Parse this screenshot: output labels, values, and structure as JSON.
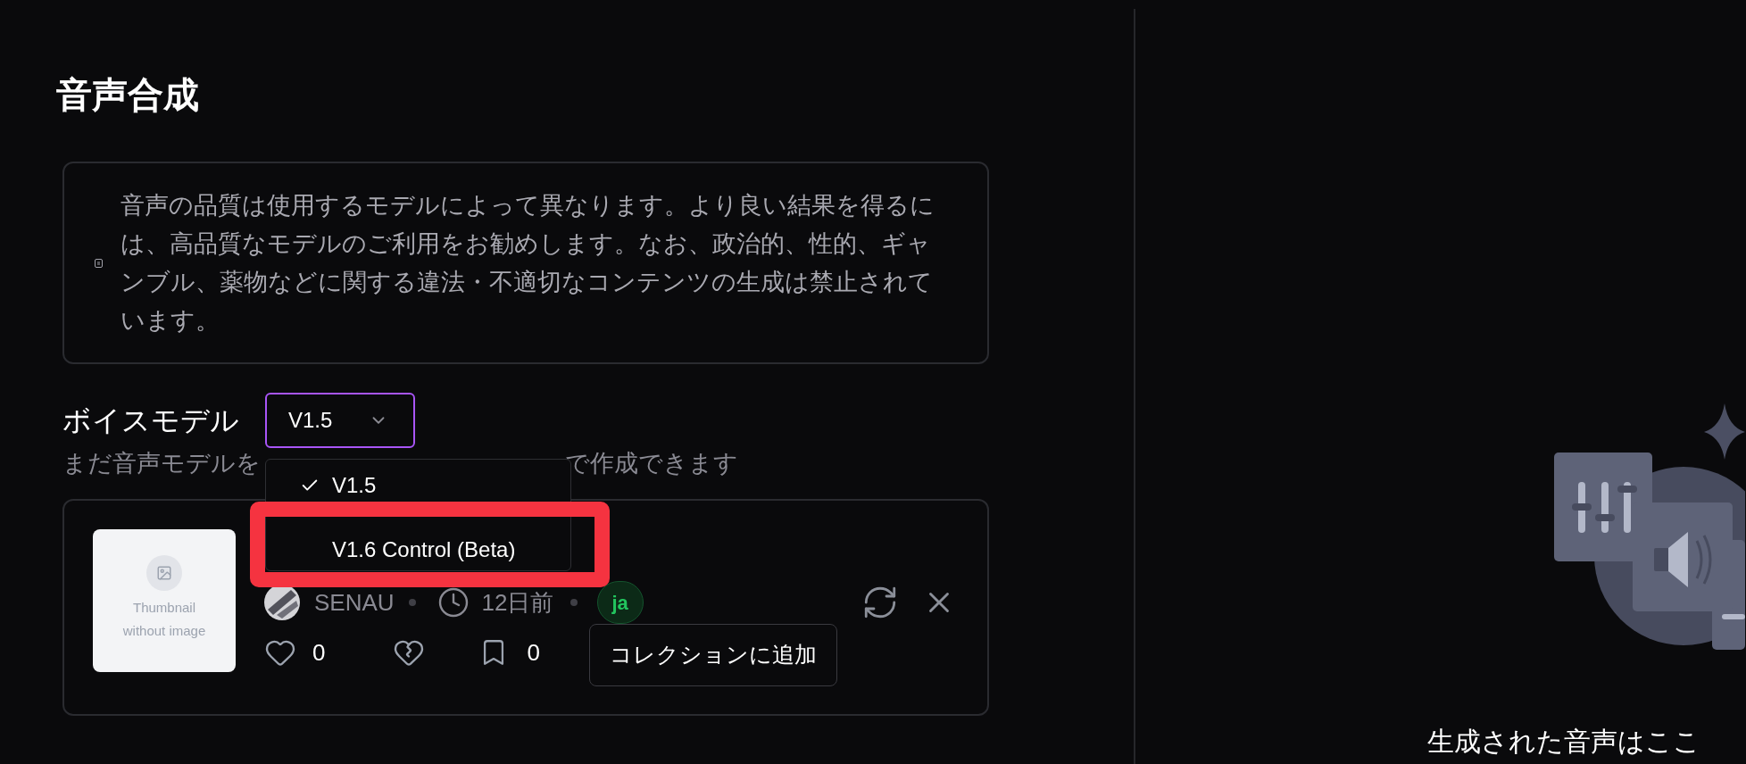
{
  "page_title": "音声合成",
  "notice": {
    "text": "音声の品質は使用するモデルによって異なります。より良い結果を得るには、高品質なモデルのご利用をお勧めします。なお、政治的、性的、ギャンブル、薬物などに関する違法・不適切なコンテンツの生成は禁止されています。"
  },
  "voice_model": {
    "label": "ボイスモデル",
    "value": "V1.5",
    "hint_before": "まだ音声モデルを",
    "hint_after": "で作成できます",
    "menu": [
      {
        "label": "V1.5",
        "selected": true
      },
      {
        "label": "V1.6 Control (Beta)",
        "selected": false
      }
    ]
  },
  "voice_card": {
    "thumbnail_lines": [
      "Thumbnail",
      "without image"
    ],
    "author": "SENAU",
    "age": "12日前",
    "language": "ja",
    "likes": "0",
    "bookmarks": "0",
    "tooltip": "コレクションに追加"
  },
  "output_panel": {
    "empty_message": "生成された音声はここ"
  }
}
